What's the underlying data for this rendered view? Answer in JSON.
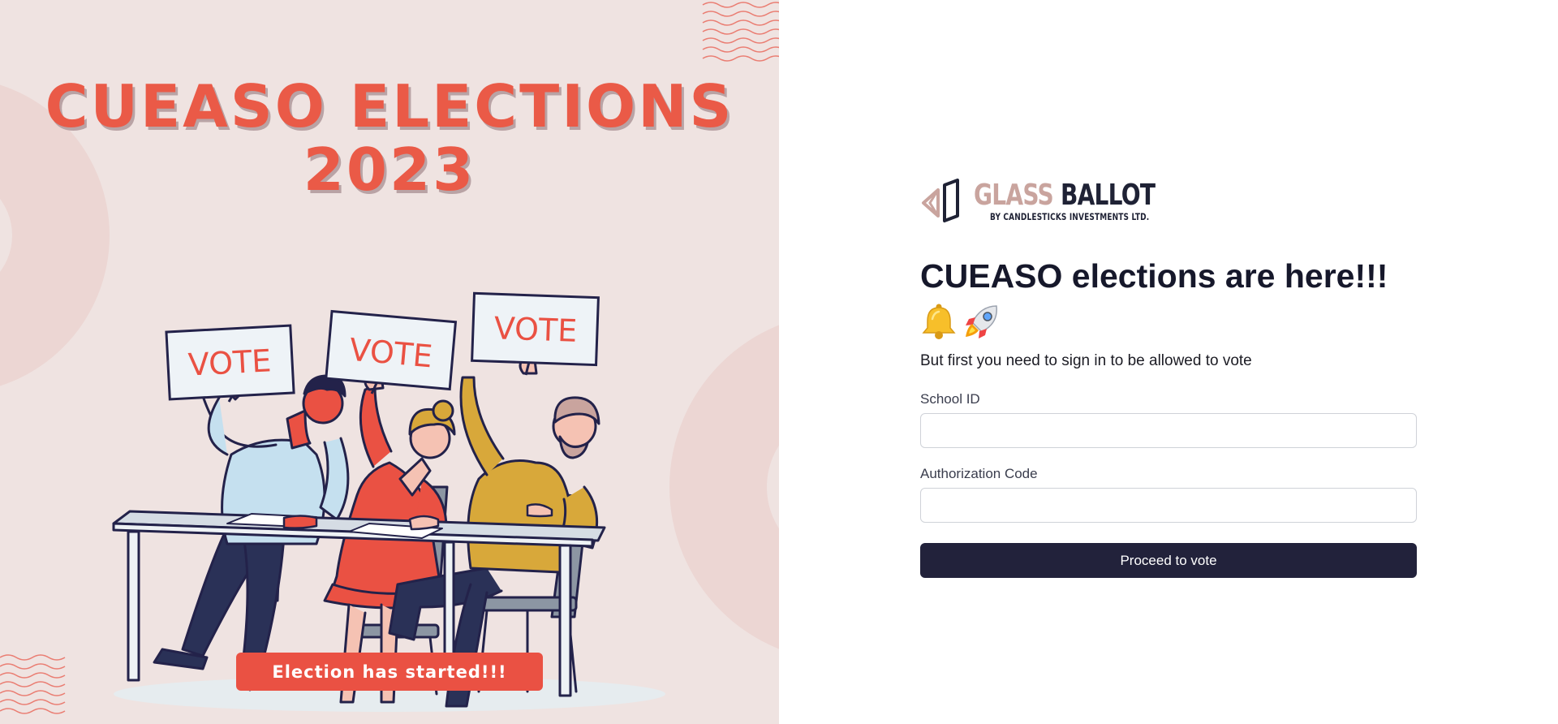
{
  "poster": {
    "title_line1": "CUEASO ELECTIONS",
    "title_line2": "2023",
    "sign_text": "VOTE",
    "badge": "Election has started!!!"
  },
  "brand": {
    "logo_word1": "GLASS",
    "logo_word2": "BALLOT",
    "logo_tagline": "BY CANDLESTICKS INVESTMENTS LTD."
  },
  "form": {
    "heading": "CUEASO elections are here!!!",
    "emojis": [
      "bell-icon",
      "rocket-icon"
    ],
    "subtext": "But first you need to sign in to be allowed to vote",
    "school_id_label": "School ID",
    "school_id_value": "",
    "auth_code_label": "Authorization Code",
    "auth_code_value": "",
    "submit_label": "Proceed to vote"
  },
  "colors": {
    "poster_bg": "#efe3e1",
    "accent_red": "#ea5143",
    "button_dark": "#22223b",
    "logo_tan": "#c9a49e"
  }
}
